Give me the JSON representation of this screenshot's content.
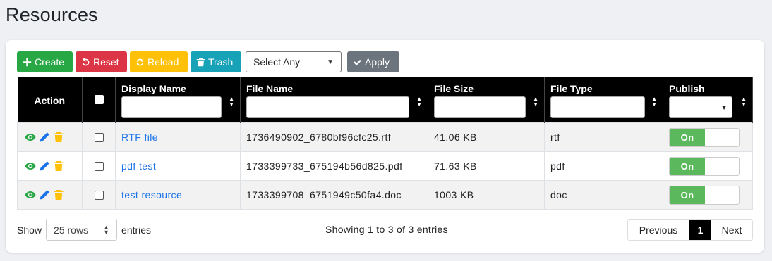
{
  "page": {
    "title": "Resources"
  },
  "toolbar": {
    "create_label": "Create",
    "reset_label": "Reset",
    "reload_label": "Reload",
    "trash_label": "Trash",
    "bulk_select_value": "Select Any",
    "apply_label": "Apply"
  },
  "table": {
    "headers": {
      "action": "Action",
      "display_name": "Display Name",
      "file_name": "File Name",
      "file_size": "File Size",
      "file_type": "File Type",
      "publish": "Publish"
    },
    "rows": [
      {
        "display_name": "RTF file",
        "file_name": "1736490902_6780bf96cfc25.rtf",
        "file_size": "41.06 KB",
        "file_type": "rtf",
        "publish": "On"
      },
      {
        "display_name": "pdf test",
        "file_name": "1733399733_675194b56d825.pdf",
        "file_size": "71.63 KB",
        "file_type": "pdf",
        "publish": "On"
      },
      {
        "display_name": "test resource",
        "file_name": "1733399708_6751949c50fa4.doc",
        "file_size": "1003 KB",
        "file_type": "doc",
        "publish": "On"
      }
    ]
  },
  "footer": {
    "show_label": "Show",
    "rows_select_value": "25 rows",
    "entries_label": "entries",
    "showing_text": "Showing 1 to 3 of 3 entries",
    "prev_label": "Previous",
    "current_page": "1",
    "next_label": "Next"
  },
  "colors": {
    "create": "#28a745",
    "reset": "#dc3545",
    "reload": "#ffc107",
    "trash": "#17a2b8",
    "apply": "#6c757d",
    "publish_on": "#5cb85c",
    "header_bg": "#000000",
    "link": "#1a73e8"
  },
  "icons": {
    "create": "plus-icon",
    "reset": "undo-icon",
    "reload": "refresh-icon",
    "trash": "trash-icon",
    "apply": "check-icon",
    "row_view": "eye-icon",
    "row_edit": "pencil-icon",
    "row_delete": "trash-icon"
  }
}
